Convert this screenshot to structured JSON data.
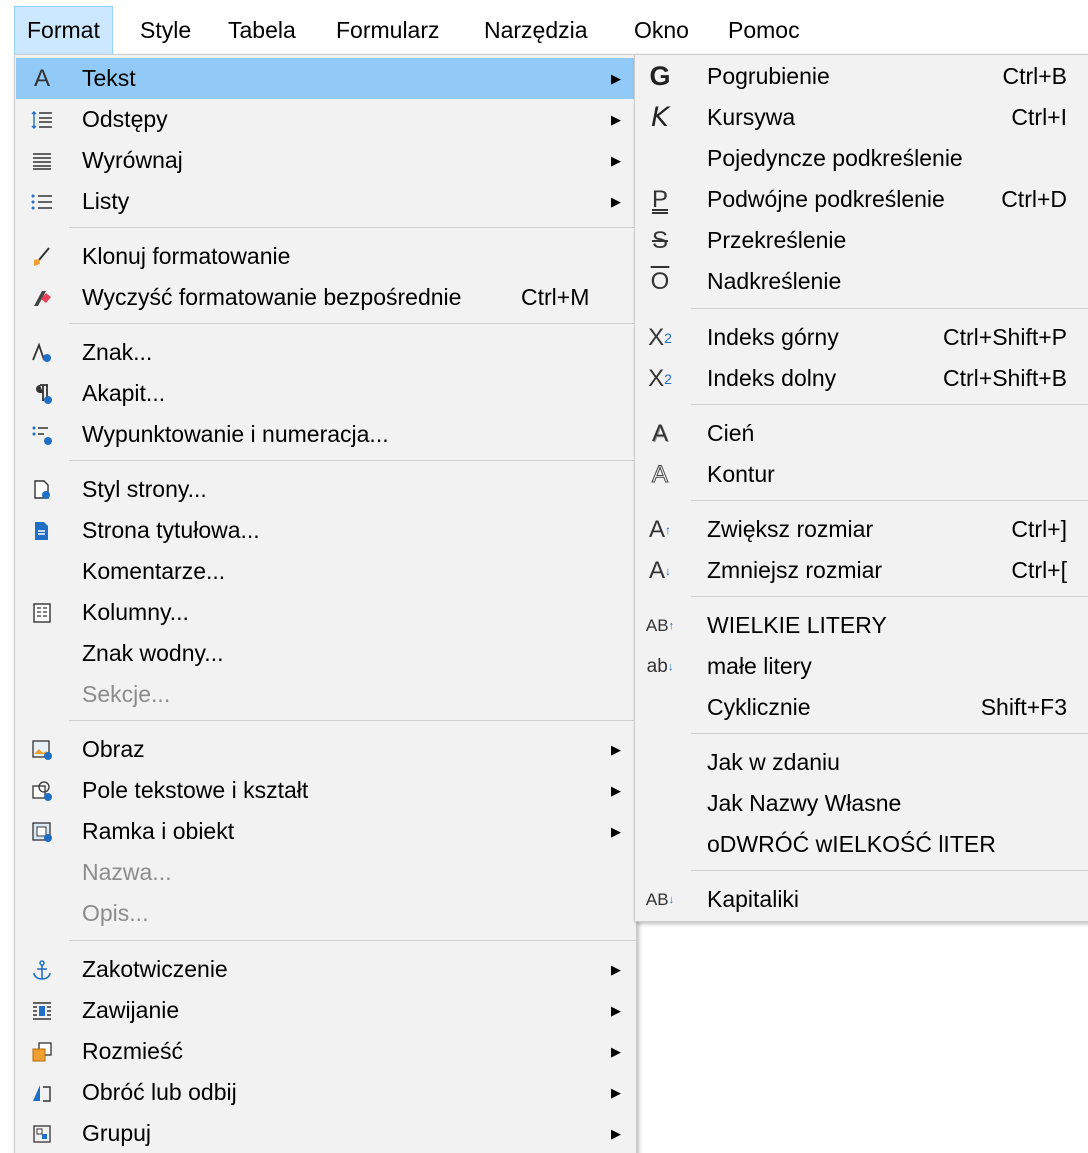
{
  "menubar": {
    "items": [
      "Format",
      "Style",
      "Tabela",
      "Formularz",
      "Narzędzia",
      "Okno",
      "Pomoc"
    ],
    "active": "Format"
  },
  "main_menu": {
    "items": [
      {
        "label": "Tekst",
        "icon": "text-A-icon",
        "submenu": true,
        "highlighted": true
      },
      {
        "label": "Odstępy",
        "icon": "spacing-icon",
        "submenu": true
      },
      {
        "label": "Wyrównaj",
        "icon": "align-icon",
        "submenu": true
      },
      {
        "label": "Listy",
        "icon": "list-icon",
        "submenu": true
      },
      {
        "label": "Klonuj formatowanie",
        "icon": "clone-format-brush-icon"
      },
      {
        "label": "Wyczyść formatowanie bezpośrednie",
        "icon": "clear-format-eraser-icon",
        "shortcut": "Ctrl+M"
      },
      {
        "label": "Znak...",
        "icon": "character-icon"
      },
      {
        "label": "Akapit...",
        "icon": "paragraph-icon"
      },
      {
        "label": "Wypunktowanie i numeracja...",
        "icon": "bullets-numbering-icon"
      },
      {
        "label": "Styl strony...",
        "icon": "page-style-icon"
      },
      {
        "label": "Strona tytułowa...",
        "icon": "title-page-icon"
      },
      {
        "label": "Komentarze...",
        "icon": ""
      },
      {
        "label": "Kolumny...",
        "icon": "columns-icon"
      },
      {
        "label": "Znak wodny...",
        "icon": ""
      },
      {
        "label": "Sekcje...",
        "icon": "",
        "disabled": true
      },
      {
        "label": "Obraz",
        "icon": "image-icon",
        "submenu": true
      },
      {
        "label": "Pole tekstowe i kształt",
        "icon": "textbox-shape-icon",
        "submenu": true
      },
      {
        "label": "Ramka i obiekt",
        "icon": "frame-object-icon",
        "submenu": true
      },
      {
        "label": "Nazwa...",
        "icon": "",
        "disabled": true
      },
      {
        "label": "Opis...",
        "icon": "",
        "disabled": true
      },
      {
        "label": "Zakotwiczenie",
        "icon": "anchor-icon",
        "submenu": true
      },
      {
        "label": "Zawijanie",
        "icon": "wrap-icon",
        "submenu": true
      },
      {
        "label": "Rozmieść",
        "icon": "arrange-icon",
        "submenu": true
      },
      {
        "label": "Obróć lub odbij",
        "icon": "rotate-flip-icon",
        "submenu": true
      },
      {
        "label": "Grupuj",
        "icon": "group-icon",
        "submenu": true
      }
    ]
  },
  "sub_menu": {
    "items": [
      {
        "label": "Pogrubienie",
        "icon": "bold-icon",
        "glyph": "G",
        "shortcut": "Ctrl+B"
      },
      {
        "label": "Kursywa",
        "icon": "italic-icon",
        "glyph": "K",
        "shortcut": "Ctrl+I"
      },
      {
        "label": "Pojedyncze podkreślenie",
        "icon": "",
        "glyph": ""
      },
      {
        "label": "Podwójne podkreślenie",
        "icon": "double-underline-icon",
        "glyph": "P",
        "shortcut": "Ctrl+D"
      },
      {
        "label": "Przekreślenie",
        "icon": "strikethrough-icon",
        "glyph": "S"
      },
      {
        "label": "Nadkreślenie",
        "icon": "overline-icon",
        "glyph": "O"
      },
      {
        "label": "Indeks górny",
        "icon": "superscript-icon",
        "glyph": "X",
        "shortcut": "Ctrl+Shift+P"
      },
      {
        "label": "Indeks dolny",
        "icon": "subscript-icon",
        "glyph": "X",
        "shortcut": "Ctrl+Shift+B"
      },
      {
        "label": "Cień",
        "icon": "shadow-icon",
        "glyph": "A"
      },
      {
        "label": "Kontur",
        "icon": "outline-icon",
        "glyph": "A"
      },
      {
        "label": "Zwiększ rozmiar",
        "icon": "grow-font-icon",
        "glyph": "A",
        "shortcut": "Ctrl+]"
      },
      {
        "label": "Zmniejsz rozmiar",
        "icon": "shrink-font-icon",
        "glyph": "A",
        "shortcut": "Ctrl+["
      },
      {
        "label": "WIELKIE LITERY",
        "icon": "uppercase-icon",
        "glyph": "AB"
      },
      {
        "label": "małe litery",
        "icon": "lowercase-icon",
        "glyph": "ab"
      },
      {
        "label": "Cyklicznie",
        "icon": "",
        "glyph": "",
        "shortcut": "Shift+F3"
      },
      {
        "label": "Jak w zdaniu",
        "icon": "",
        "glyph": ""
      },
      {
        "label": "Jak Nazwy Własne",
        "icon": "",
        "glyph": ""
      },
      {
        "label": "oDWRÓĆ wIELKOŚĆ lITER",
        "icon": "",
        "glyph": ""
      },
      {
        "label": "Kapitaliki",
        "icon": "small-caps-icon",
        "glyph": "AB"
      }
    ]
  },
  "colors": {
    "menu_background": "#f2f2f2",
    "highlight": "#91c9f7",
    "menubar_active": "#cce8ff",
    "disabled_text": "#8c8c8c",
    "icon_accent": "#1f6fc5"
  }
}
